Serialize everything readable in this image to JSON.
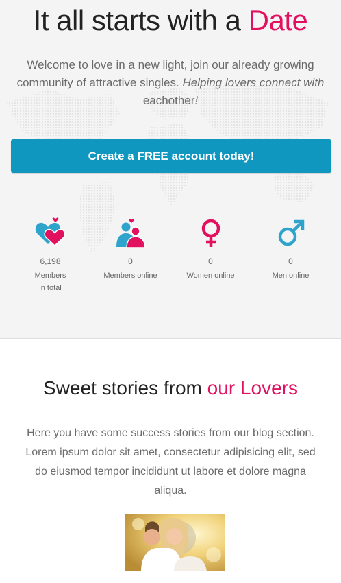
{
  "hero": {
    "title_prefix": "It all starts with a ",
    "title_accent": "Date",
    "subtitle_plain": "Welcome to love in a new light, join our already growing community of attractive singles. ",
    "subtitle_italic": "Helping lovers connect with",
    "subtitle_end": " eachother",
    "subtitle_bang": "!",
    "cta_label": "Create a FREE account today!"
  },
  "stats": [
    {
      "icon": "hearts-icon",
      "value": "6,198",
      "label": "Members in total"
    },
    {
      "icon": "couple-icon",
      "value": "0",
      "label": "Members online"
    },
    {
      "icon": "female-symbol-icon",
      "value": "0",
      "label": "Women online"
    },
    {
      "icon": "male-symbol-icon",
      "value": "0",
      "label": "Men online"
    }
  ],
  "stories": {
    "title_prefix": "Sweet stories from ",
    "title_accent": "our Lovers",
    "body": "Here you have some success stories from our blog section. Lorem ipsum dolor sit amet, consectetur adipisicing elit, sed do eiusmod tempor incididunt ut labore et dolore magna aliqua."
  },
  "colors": {
    "accent_pink": "#e2115f",
    "accent_blue": "#0f97c0",
    "heart_blue": "#2ea3cc"
  }
}
